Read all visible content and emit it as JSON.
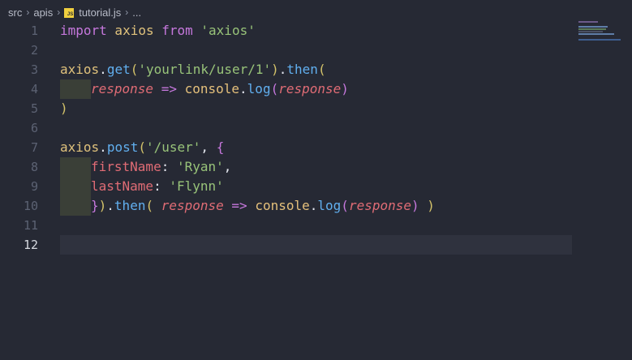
{
  "breadcrumb": {
    "items": [
      "src",
      "apis",
      "tutorial.js",
      "..."
    ]
  },
  "editor": {
    "line_numbers": [
      "1",
      "2",
      "3",
      "4",
      "5",
      "6",
      "7",
      "8",
      "9",
      "10",
      "11",
      "12"
    ],
    "current_line": "12",
    "lines": {
      "l1": [
        "import",
        " axios ",
        "from",
        " ",
        "'axios'"
      ],
      "l3": [
        "axios",
        ".",
        "get",
        "(",
        "'yourlink/user/1'",
        ")",
        ".",
        "then",
        "("
      ],
      "l4": [
        "response",
        " => ",
        "console",
        ".",
        "log",
        "(",
        "response",
        ")"
      ],
      "l5": [
        ")"
      ],
      "l7": [
        "axios",
        ".",
        "post",
        "(",
        "'/user'",
        ", ",
        "{"
      ],
      "l8": [
        "firstName",
        ": ",
        "'Ryan'",
        ","
      ],
      "l9": [
        "lastName",
        ": ",
        "'Flynn'"
      ],
      "l10": [
        "}",
        ")",
        ".",
        "then",
        "( ",
        "response",
        " => ",
        "console",
        ".",
        "log",
        "(",
        "response",
        ")",
        " )"
      ]
    }
  },
  "colors": {
    "background": "#262934",
    "keyword": "#c678dd",
    "string": "#98c379",
    "function": "#61afef",
    "parameter": "#e06c75"
  },
  "icons": [
    "chevron-right-icon",
    "javascript-file-icon"
  ]
}
